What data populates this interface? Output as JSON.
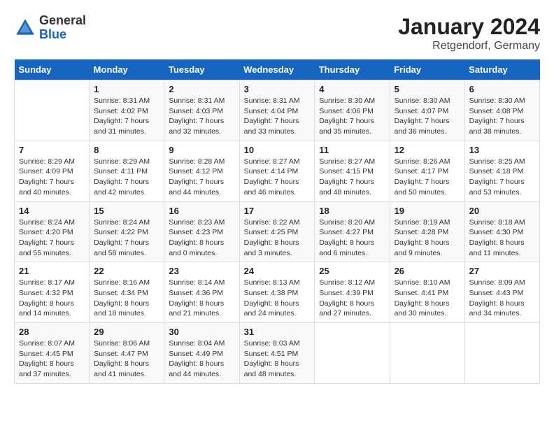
{
  "logo": {
    "general": "General",
    "blue": "Blue"
  },
  "title": "January 2024",
  "subtitle": "Retgendorf, Germany",
  "days_of_week": [
    "Sunday",
    "Monday",
    "Tuesday",
    "Wednesday",
    "Thursday",
    "Friday",
    "Saturday"
  ],
  "weeks": [
    [
      {
        "day": "",
        "info": ""
      },
      {
        "day": "1",
        "info": "Sunrise: 8:31 AM\nSunset: 4:02 PM\nDaylight: 7 hours\nand 31 minutes."
      },
      {
        "day": "2",
        "info": "Sunrise: 8:31 AM\nSunset: 4:03 PM\nDaylight: 7 hours\nand 32 minutes."
      },
      {
        "day": "3",
        "info": "Sunrise: 8:31 AM\nSunset: 4:04 PM\nDaylight: 7 hours\nand 33 minutes."
      },
      {
        "day": "4",
        "info": "Sunrise: 8:30 AM\nSunset: 4:06 PM\nDaylight: 7 hours\nand 35 minutes."
      },
      {
        "day": "5",
        "info": "Sunrise: 8:30 AM\nSunset: 4:07 PM\nDaylight: 7 hours\nand 36 minutes."
      },
      {
        "day": "6",
        "info": "Sunrise: 8:30 AM\nSunset: 4:08 PM\nDaylight: 7 hours\nand 38 minutes."
      }
    ],
    [
      {
        "day": "7",
        "info": "Sunrise: 8:29 AM\nSunset: 4:09 PM\nDaylight: 7 hours\nand 40 minutes."
      },
      {
        "day": "8",
        "info": "Sunrise: 8:29 AM\nSunset: 4:11 PM\nDaylight: 7 hours\nand 42 minutes."
      },
      {
        "day": "9",
        "info": "Sunrise: 8:28 AM\nSunset: 4:12 PM\nDaylight: 7 hours\nand 44 minutes."
      },
      {
        "day": "10",
        "info": "Sunrise: 8:27 AM\nSunset: 4:14 PM\nDaylight: 7 hours\nand 46 minutes."
      },
      {
        "day": "11",
        "info": "Sunrise: 8:27 AM\nSunset: 4:15 PM\nDaylight: 7 hours\nand 48 minutes."
      },
      {
        "day": "12",
        "info": "Sunrise: 8:26 AM\nSunset: 4:17 PM\nDaylight: 7 hours\nand 50 minutes."
      },
      {
        "day": "13",
        "info": "Sunrise: 8:25 AM\nSunset: 4:18 PM\nDaylight: 7 hours\nand 53 minutes."
      }
    ],
    [
      {
        "day": "14",
        "info": "Sunrise: 8:24 AM\nSunset: 4:20 PM\nDaylight: 7 hours\nand 55 minutes."
      },
      {
        "day": "15",
        "info": "Sunrise: 8:24 AM\nSunset: 4:22 PM\nDaylight: 7 hours\nand 58 minutes."
      },
      {
        "day": "16",
        "info": "Sunrise: 8:23 AM\nSunset: 4:23 PM\nDaylight: 8 hours\nand 0 minutes."
      },
      {
        "day": "17",
        "info": "Sunrise: 8:22 AM\nSunset: 4:25 PM\nDaylight: 8 hours\nand 3 minutes."
      },
      {
        "day": "18",
        "info": "Sunrise: 8:20 AM\nSunset: 4:27 PM\nDaylight: 8 hours\nand 6 minutes."
      },
      {
        "day": "19",
        "info": "Sunrise: 8:19 AM\nSunset: 4:28 PM\nDaylight: 8 hours\nand 9 minutes."
      },
      {
        "day": "20",
        "info": "Sunrise: 8:18 AM\nSunset: 4:30 PM\nDaylight: 8 hours\nand 11 minutes."
      }
    ],
    [
      {
        "day": "21",
        "info": "Sunrise: 8:17 AM\nSunset: 4:32 PM\nDaylight: 8 hours\nand 14 minutes."
      },
      {
        "day": "22",
        "info": "Sunrise: 8:16 AM\nSunset: 4:34 PM\nDaylight: 8 hours\nand 18 minutes."
      },
      {
        "day": "23",
        "info": "Sunrise: 8:14 AM\nSunset: 4:36 PM\nDaylight: 8 hours\nand 21 minutes."
      },
      {
        "day": "24",
        "info": "Sunrise: 8:13 AM\nSunset: 4:38 PM\nDaylight: 8 hours\nand 24 minutes."
      },
      {
        "day": "25",
        "info": "Sunrise: 8:12 AM\nSunset: 4:39 PM\nDaylight: 8 hours\nand 27 minutes."
      },
      {
        "day": "26",
        "info": "Sunrise: 8:10 AM\nSunset: 4:41 PM\nDaylight: 8 hours\nand 30 minutes."
      },
      {
        "day": "27",
        "info": "Sunrise: 8:09 AM\nSunset: 4:43 PM\nDaylight: 8 hours\nand 34 minutes."
      }
    ],
    [
      {
        "day": "28",
        "info": "Sunrise: 8:07 AM\nSunset: 4:45 PM\nDaylight: 8 hours\nand 37 minutes."
      },
      {
        "day": "29",
        "info": "Sunrise: 8:06 AM\nSunset: 4:47 PM\nDaylight: 8 hours\nand 41 minutes."
      },
      {
        "day": "30",
        "info": "Sunrise: 8:04 AM\nSunset: 4:49 PM\nDaylight: 8 hours\nand 44 minutes."
      },
      {
        "day": "31",
        "info": "Sunrise: 8:03 AM\nSunset: 4:51 PM\nDaylight: 8 hours\nand 48 minutes."
      },
      {
        "day": "",
        "info": ""
      },
      {
        "day": "",
        "info": ""
      },
      {
        "day": "",
        "info": ""
      }
    ]
  ]
}
